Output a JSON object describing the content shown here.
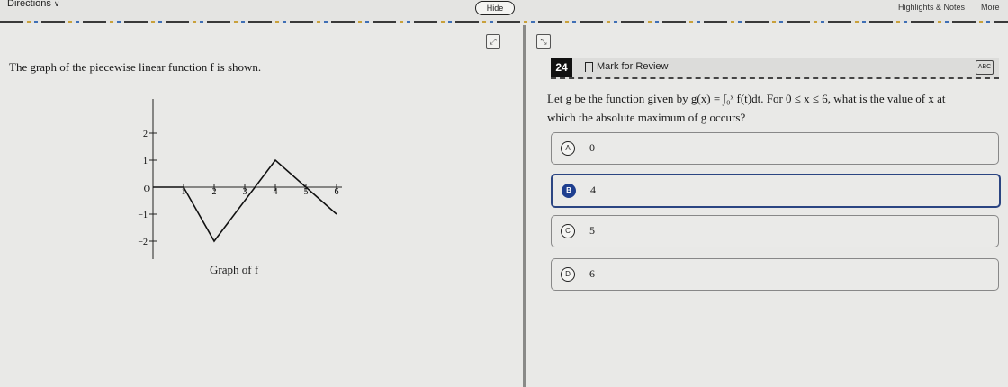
{
  "topbar": {
    "directions_label": "Directions",
    "directions_chevron": "∨",
    "hide_label": "Hide",
    "highlights_label": "Highlights & Notes",
    "more_label": "More"
  },
  "left_panel": {
    "stem": "The graph of the piecewise linear function f is shown.",
    "caption": "Graph of f",
    "graph": {
      "x_ticks": [
        "1",
        "2",
        "3",
        "4",
        "5",
        "6"
      ],
      "y_ticks": [
        "2",
        "1",
        "−1",
        "−2"
      ],
      "origin_label": "O",
      "points": [
        [
          0,
          0
        ],
        [
          1,
          0
        ],
        [
          2,
          -2
        ],
        [
          4,
          1
        ],
        [
          6,
          -1
        ]
      ]
    }
  },
  "question": {
    "number": "24",
    "mark_label": "Mark for Review",
    "abc_label": "ABC",
    "prompt_line1": "Let g be the function given by g(x) = ∫₀ˣ f(t)dt. For 0 ≤ x ≤ 6, what is the value of x at",
    "prompt_line2": "which the absolute maximum of g occurs?",
    "choices": [
      {
        "letter": "A",
        "text": "0"
      },
      {
        "letter": "B",
        "text": "4"
      },
      {
        "letter": "C",
        "text": "5"
      },
      {
        "letter": "D",
        "text": "6"
      }
    ],
    "selected_index": 1
  },
  "colors": {
    "selected": "#1f3f8f",
    "divider": "#8a8a88"
  }
}
